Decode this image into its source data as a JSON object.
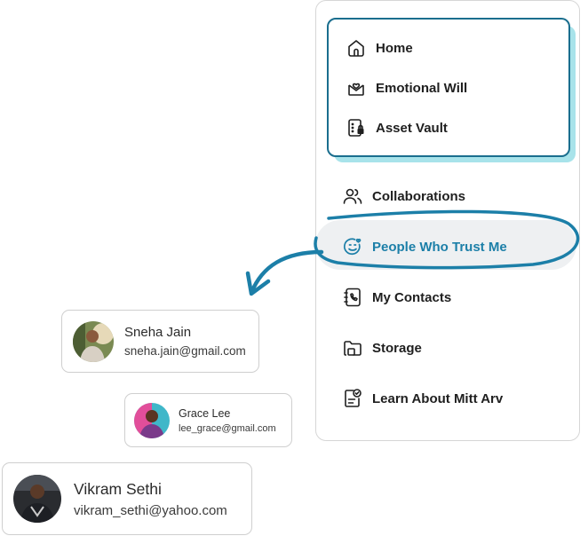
{
  "nav": {
    "top_group": [
      {
        "label": "Home",
        "icon": "home-icon"
      },
      {
        "label": "Emotional Will",
        "icon": "heart-envelope-icon"
      },
      {
        "label": "Asset Vault",
        "icon": "vault-lock-icon"
      }
    ],
    "items": [
      {
        "label": "Collaborations",
        "icon": "users-icon"
      },
      {
        "label": "People Who Trust Me",
        "icon": "smile-heart-icon",
        "active": true
      },
      {
        "label": "My Contacts",
        "icon": "contacts-phone-icon"
      },
      {
        "label": "Storage",
        "icon": "folder-icon"
      },
      {
        "label": "Learn About Mitt Arv",
        "icon": "learn-check-icon"
      }
    ]
  },
  "contacts": [
    {
      "name": "Sneha Jain",
      "email": "sneha.jain@gmail.com"
    },
    {
      "name": "Grace Lee",
      "email": "lee_grace@gmail.com"
    },
    {
      "name": "Vikram Sethi",
      "email": "vikram_sethi@yahoo.com"
    }
  ],
  "colors": {
    "accent": "#1c7fa8",
    "frame_border": "#1a6e8e",
    "frame_shadow": "#a8e3ea",
    "highlight_bg": "#eef0f2"
  }
}
